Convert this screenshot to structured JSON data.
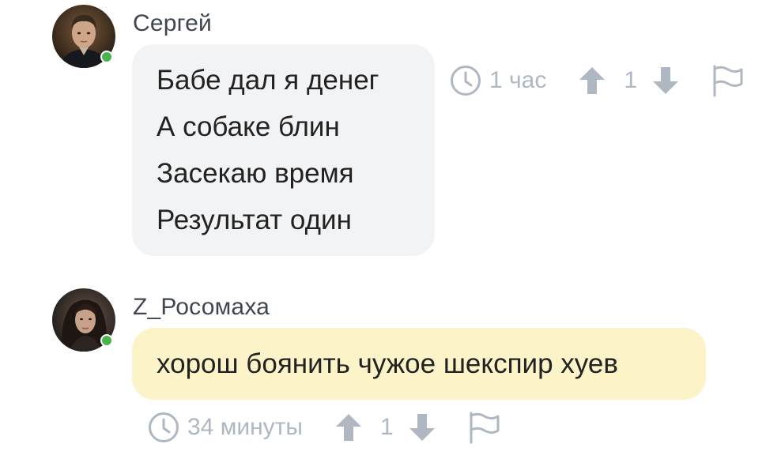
{
  "comments": [
    {
      "author": "Сергей",
      "lines": [
        "Бабе дал я денег",
        "А собаке блин",
        "Засекаю время",
        "Результат один"
      ],
      "time": "1 час",
      "votes": "1",
      "online": true,
      "bubble_color": "#f2f3f5"
    },
    {
      "author": "Z_Росомаха",
      "lines": [
        "хорош боянить чужое шекспир хуев"
      ],
      "time": "34 минуты",
      "votes": "1",
      "online": true,
      "bubble_color": "#fcf3c8"
    }
  ],
  "icons": {
    "time": "clock-icon",
    "upvote": "arrow-up-icon",
    "downvote": "arrow-down-icon",
    "report": "flag-icon"
  },
  "colors": {
    "author_text": "#3f4650",
    "meta_text": "#aeb7c2",
    "online_dot": "#4bb34b"
  }
}
